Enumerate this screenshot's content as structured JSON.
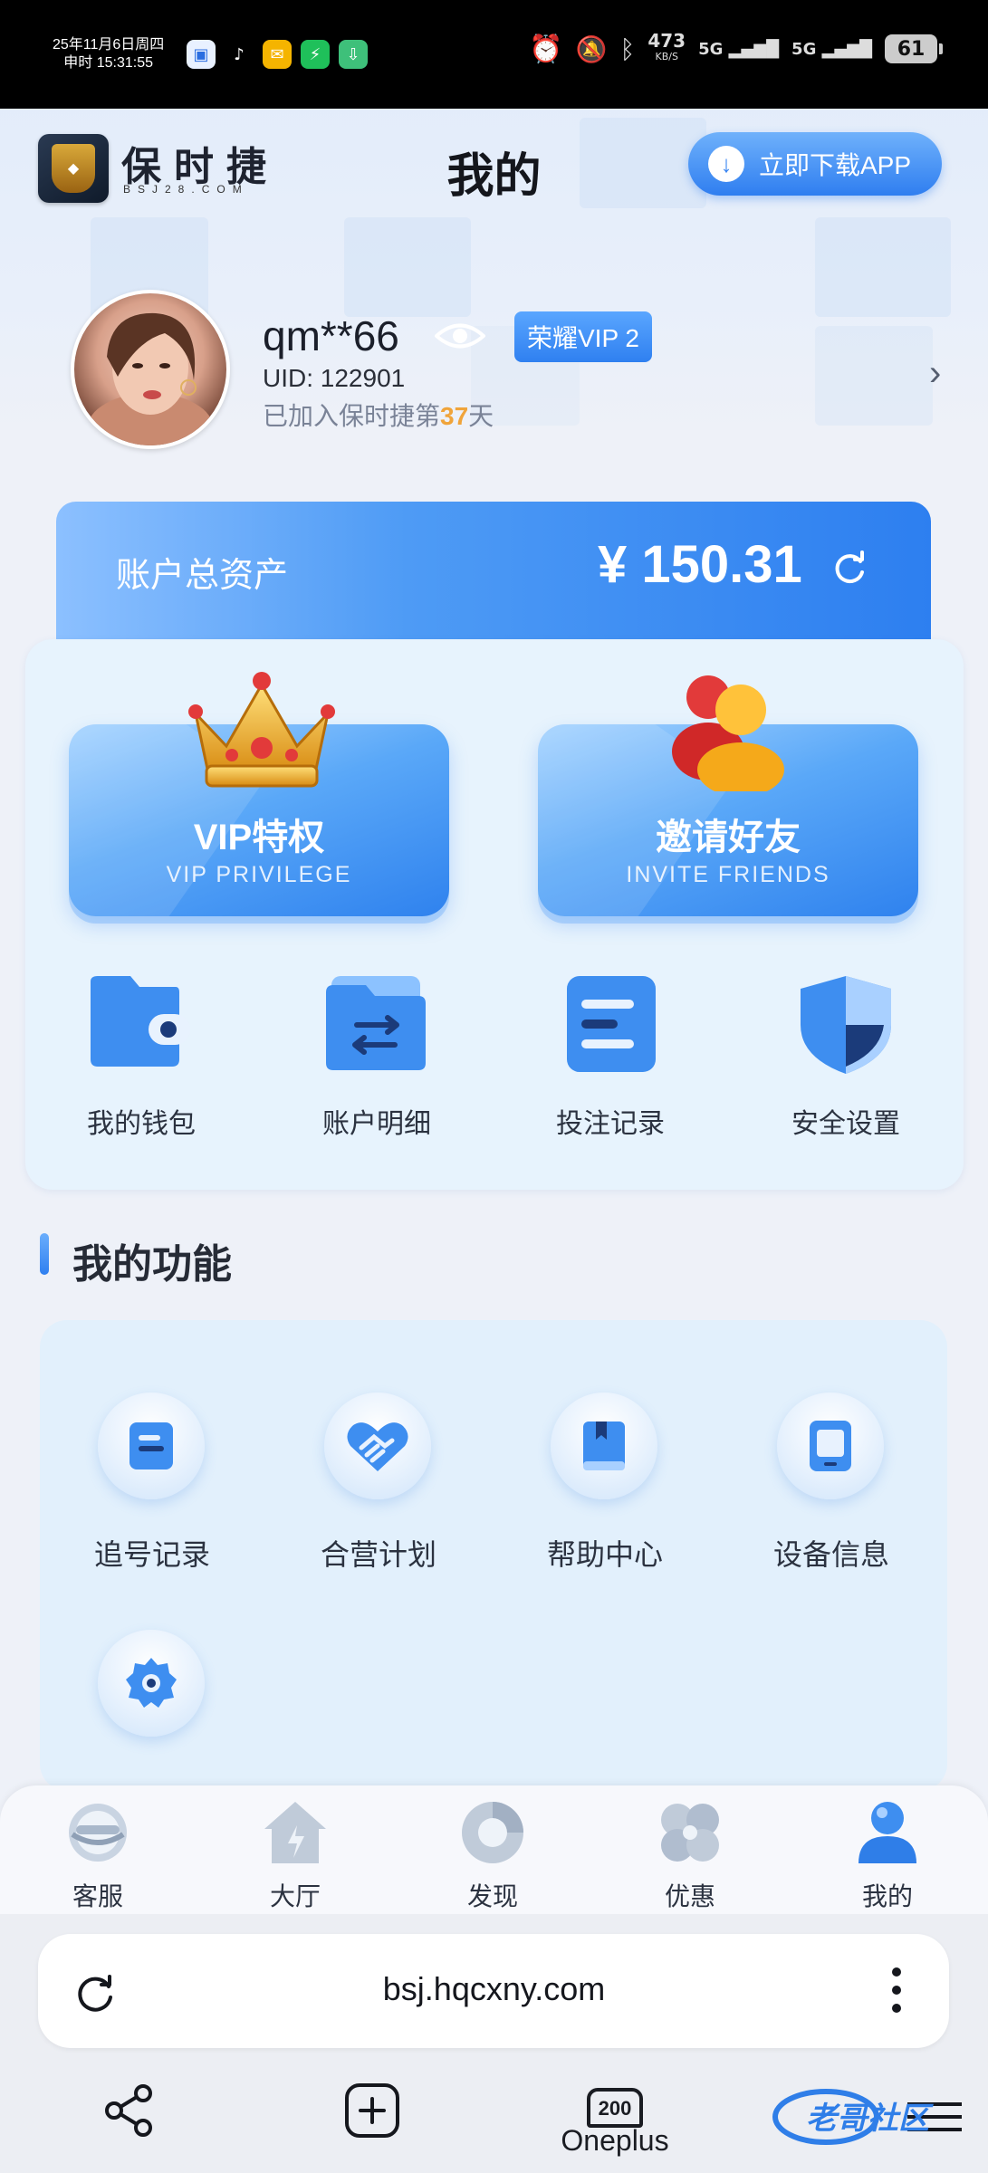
{
  "status_bar": {
    "date_line1": "25年11月6日周四",
    "date_line2": "申时 15:31:55",
    "net_speed": "473",
    "net_unit": "KB/S",
    "signal1": "5G",
    "signal2": "5G",
    "battery": "61"
  },
  "header": {
    "brand_name": "保时捷",
    "brand_domain": "BSJ28.COM",
    "page_title": "我的",
    "download_button": "立即下载APP"
  },
  "profile": {
    "username": "qm**66",
    "vip_badge": "荣耀VIP 2",
    "uid": "UID: 122901",
    "joined_prefix": "已加入保时捷第",
    "joined_days": "37",
    "joined_suffix": "天"
  },
  "assets": {
    "label": "账户总资产",
    "value": "¥ 150.31"
  },
  "feature_cards": [
    {
      "title": "VIP特权",
      "subtitle": "VIP PRIVILEGE"
    },
    {
      "title": "邀请好友",
      "subtitle": "INVITE FRIENDS"
    }
  ],
  "quick_actions": [
    {
      "label": "我的钱包",
      "icon": "wallet-icon"
    },
    {
      "label": "账户明细",
      "icon": "folder-transfer-icon"
    },
    {
      "label": "投注记录",
      "icon": "record-list-icon"
    },
    {
      "label": "安全设置",
      "icon": "shield-icon"
    }
  ],
  "functions": {
    "section_title": "我的功能",
    "items": [
      {
        "label": "追号记录",
        "icon": "document-icon"
      },
      {
        "label": "合营计划",
        "icon": "handshake-icon"
      },
      {
        "label": "帮助中心",
        "icon": "book-icon"
      },
      {
        "label": "设备信息",
        "icon": "tablet-icon"
      },
      {
        "label": "",
        "icon": "gear-icon"
      }
    ]
  },
  "tab_bar": {
    "items": [
      {
        "label": "客服",
        "icon": "support-icon"
      },
      {
        "label": "大厅",
        "icon": "home-icon"
      },
      {
        "label": "发现",
        "icon": "discover-icon"
      },
      {
        "label": "优惠",
        "icon": "promo-icon"
      },
      {
        "label": "我的",
        "icon": "profile-icon",
        "active": true
      }
    ]
  },
  "browser": {
    "url": "bsj.hqcxny.com",
    "tabs_count": "200",
    "brand_label": "Oneplus",
    "watermark": "老哥社区"
  },
  "colors": {
    "accent": "#2f80f0",
    "accent_light": "#6fb1fb",
    "gold": "#f0a43a",
    "panel": "#e7f3fd"
  }
}
